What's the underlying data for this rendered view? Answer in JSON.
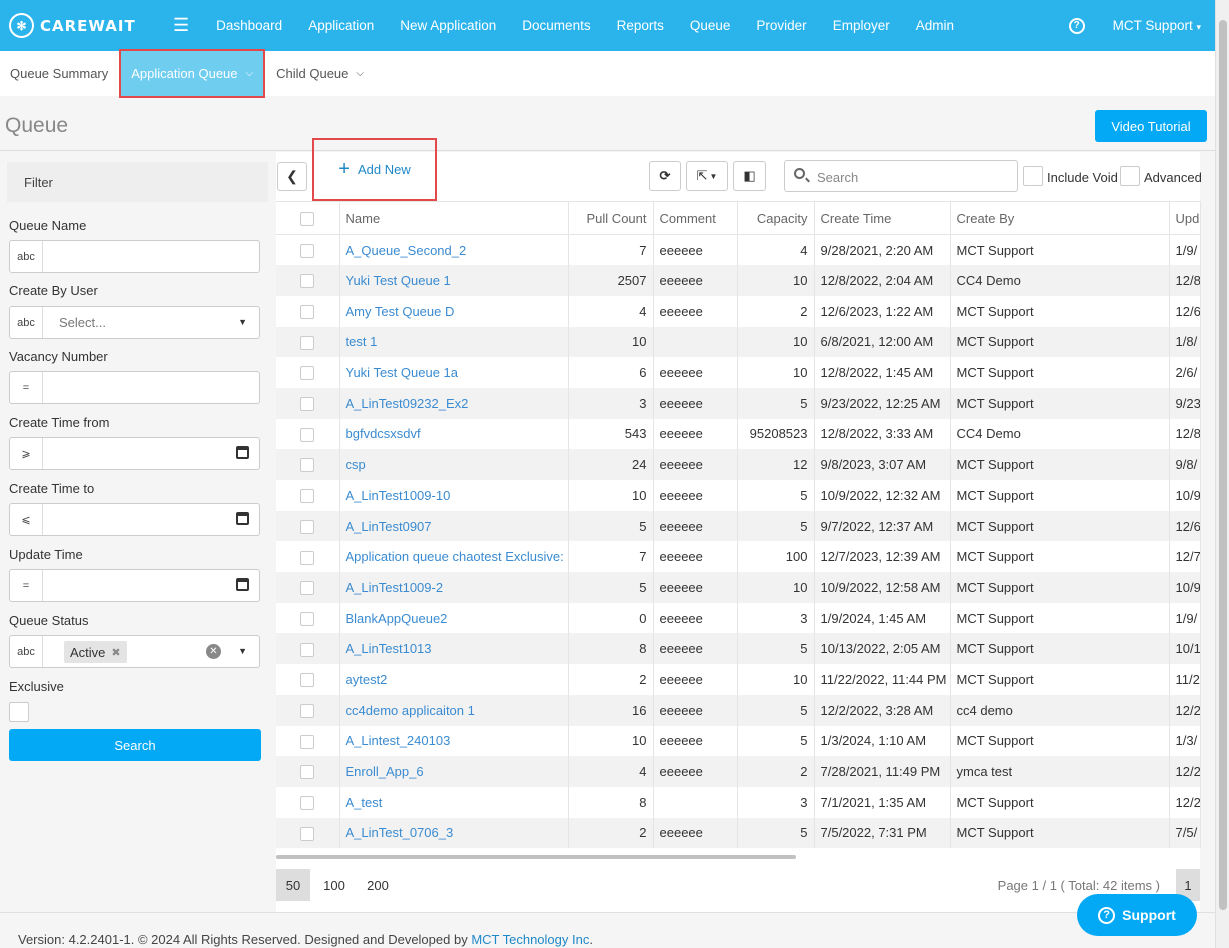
{
  "brand": {
    "logo_text": "CAREWAIT"
  },
  "nav": {
    "items": [
      "Dashboard",
      "Application",
      "New Application",
      "Documents",
      "Reports",
      "Queue",
      "Provider",
      "Employer",
      "Admin"
    ],
    "user": "MCT Support",
    "help": "?"
  },
  "subtabs": {
    "summary": "Queue Summary",
    "application": "Application Queue",
    "child": "Child Queue"
  },
  "page": {
    "title": "Queue",
    "video_tutorial": "Video Tutorial"
  },
  "filter": {
    "header": "Filter",
    "queue_name": "Queue Name",
    "create_by_user": "Create By User",
    "create_by_placeholder": "Select...",
    "vacancy_number": "Vacancy Number",
    "create_time_from": "Create Time from",
    "create_time_to": "Create Time to",
    "update_time": "Update Time",
    "queue_status": "Queue Status",
    "status_tag": "Active",
    "exclusive": "Exclusive",
    "search_button": "Search",
    "prefix_text": "abc",
    "prefix_eq": "=",
    "prefix_ge": "⩾",
    "prefix_le": "⩽"
  },
  "toolbar": {
    "add_new": "Add New",
    "search_placeholder": "Search",
    "include_void": "Include Void",
    "advanced": "Advanced"
  },
  "table": {
    "columns": [
      "Name",
      "Pull Count",
      "Comment",
      "Capacity",
      "Create Time",
      "Create By",
      "Upda"
    ],
    "rows": [
      [
        "A_Queue_Second_2",
        "7",
        "eeeeee",
        "4",
        "9/28/2021, 2:20 AM",
        "MCT Support",
        "1/9/"
      ],
      [
        "Yuki Test Queue 1",
        "2507",
        "eeeeee",
        "10",
        "12/8/2022, 2:04 AM",
        "CC4 Demo",
        "12/8"
      ],
      [
        "Amy Test Queue D",
        "4",
        "eeeeee",
        "2",
        "12/6/2023, 1:22 AM",
        "MCT Support",
        "12/6"
      ],
      [
        "test 1",
        "10",
        "",
        "10",
        "6/8/2021, 12:00 AM",
        "MCT Support",
        "1/8/"
      ],
      [
        "Yuki Test Queue 1a",
        "6",
        "eeeeee",
        "10",
        "12/8/2022, 1:45 AM",
        "MCT Support",
        "2/6/"
      ],
      [
        "A_LinTest09232_Ex2",
        "3",
        "eeeeee",
        "5",
        "9/23/2022, 12:25 AM",
        "MCT Support",
        "9/23"
      ],
      [
        "bgfvdcsxsdvf",
        "543",
        "eeeeee",
        "95208523",
        "12/8/2022, 3:33 AM",
        "CC4 Demo",
        "12/8"
      ],
      [
        "csp",
        "24",
        "eeeeee",
        "12",
        "9/8/2023, 3:07 AM",
        "MCT Support",
        "9/8/"
      ],
      [
        "A_LinTest1009-10",
        "10",
        "eeeeee",
        "5",
        "10/9/2022, 12:32 AM",
        "MCT Support",
        "10/9"
      ],
      [
        "A_LinTest0907",
        "5",
        "eeeeee",
        "5",
        "9/7/2022, 12:37 AM",
        "MCT Support",
        "12/6"
      ],
      [
        "Application queue chaotest Exclusive:",
        "7",
        "eeeeee",
        "100",
        "12/7/2023, 12:39 AM",
        "MCT Support",
        "12/7"
      ],
      [
        "A_LinTest1009-2",
        "5",
        "eeeeee",
        "10",
        "10/9/2022, 12:58 AM",
        "MCT Support",
        "10/9"
      ],
      [
        "BlankAppQueue2",
        "0",
        "eeeeee",
        "3",
        "1/9/2024, 1:45 AM",
        "MCT Support",
        "1/9/"
      ],
      [
        "A_LinTest1013",
        "8",
        "eeeeee",
        "5",
        "10/13/2022, 2:05 AM",
        "MCT Support",
        "10/1"
      ],
      [
        "aytest2",
        "2",
        "eeeeee",
        "10",
        "11/22/2022, 11:44 PM",
        "MCT Support",
        "11/2"
      ],
      [
        "cc4demo applicaiton 1",
        "16",
        "eeeeee",
        "5",
        "12/2/2022, 3:28 AM",
        "cc4 demo",
        "12/2"
      ],
      [
        "A_Lintest_240103",
        "10",
        "eeeeee",
        "5",
        "1/3/2024, 1:10 AM",
        "MCT Support",
        "1/3/"
      ],
      [
        "Enroll_App_6",
        "4",
        "eeeeee",
        "2",
        "7/28/2021, 11:49 PM",
        "ymca test",
        "12/2"
      ],
      [
        "A_test",
        "8",
        "",
        "3",
        "7/1/2021, 1:35 AM",
        "MCT Support",
        "12/2"
      ],
      [
        "A_LinTest_0706_3",
        "2",
        "eeeeee",
        "5",
        "7/5/2022, 7:31 PM",
        "MCT Support",
        "7/5/"
      ]
    ]
  },
  "pager": {
    "sizes": [
      "50",
      "100",
      "200"
    ],
    "info": "Page 1 / 1 ( Total: 42 items )",
    "current": "1"
  },
  "footer": {
    "text": "Version: 4.2.2401-1. © 2024 All Rights Reserved. Designed and Developed by ",
    "company": "MCT Technology Inc",
    "period": "."
  },
  "support": {
    "label": "Support",
    "icon": "?"
  },
  "colors": {
    "brand": "#2bb4ec",
    "accent": "#03a9f4",
    "highlight": "#e34948",
    "link": "#3a8bd1"
  }
}
